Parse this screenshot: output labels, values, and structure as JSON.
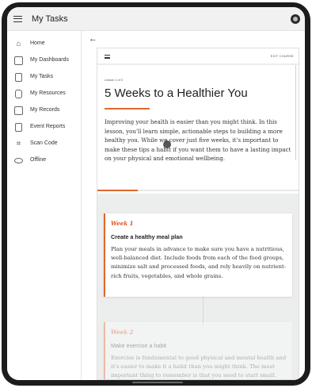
{
  "topbar": {
    "title": "My Tasks",
    "menu_icon": "hamburger-icon",
    "profile_icon": "profile-icon"
  },
  "sidebar": {
    "items": [
      {
        "label": "Home",
        "icon": "home-icon"
      },
      {
        "label": "My Dashboards",
        "icon": "dashboard-icon"
      },
      {
        "label": "My Tasks",
        "icon": "clipboard-icon"
      },
      {
        "label": "My Resources",
        "icon": "resources-icon"
      },
      {
        "label": "My Records",
        "icon": "records-icon"
      },
      {
        "label": "Event Reports",
        "icon": "report-icon"
      },
      {
        "label": "Scan Code",
        "icon": "scan-icon"
      },
      {
        "label": "Offline",
        "icon": "cloud-offline-icon"
      }
    ]
  },
  "course": {
    "exit_label": "EXIT COURSE",
    "breadcrumb": "Lesson 1 of 3",
    "title": "5 Weeks to a Healthier You",
    "intro": "Improving your health is easier than you might think. In this lesson, you'll learn simple, actionable steps to building a more healthy you. While we cover just five weeks, it's important to make these tips a habit if you want them to have a lasting impact on your physical and emotional wellbeing.",
    "progress": 0.2
  },
  "cards": [
    {
      "week": "Week 1",
      "title": "Create a healthy meal plan",
      "body": "Plan your meals in advance to make sure you have a nutritious, well-balanced diet. Include foods from each of the food groups, minimize salt and processed foods, and rely heavily on nutrient-rich fruits, vegetables, and whole grains."
    },
    {
      "week": "Week 2",
      "title": "Make exercise a habit",
      "body": "Exercise is fundamental to good physical and mental health and it's easier to make it a habit than you might think. The most important thing to remember is that you need to start small. Choose an exercise"
    }
  ],
  "colors": {
    "accent": "#e0672d"
  }
}
